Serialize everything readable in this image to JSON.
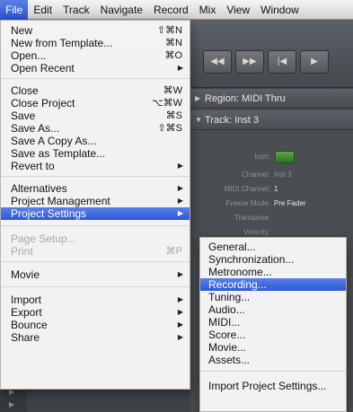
{
  "menubar": {
    "items": [
      "File",
      "Edit",
      "Track",
      "Navigate",
      "Record",
      "Mix",
      "View",
      "Window"
    ],
    "active_index": 0
  },
  "transport": {
    "buttons": [
      "◀◀",
      "▶▶",
      "|◀",
      "▶"
    ]
  },
  "inspector": {
    "region_header": "Region: MIDI Thru",
    "track_header": "Track: Inst 3",
    "icon_label": "Icon:",
    "rows": [
      {
        "label": "Channel:",
        "value": "Inst 3",
        "dim": true
      },
      {
        "label": "MIDI Channel:",
        "value": "1",
        "dim": false
      },
      {
        "label": "Freeze Mode:",
        "value": "Pre Fader",
        "dim": false
      },
      {
        "label": "Transpose:",
        "value": "",
        "dim": false
      },
      {
        "label": "Velocity:",
        "value": "",
        "dim": false
      }
    ]
  },
  "file_menu": {
    "items": [
      {
        "label": "New",
        "shortcut": "⇧⌘N"
      },
      {
        "label": "New from Template...",
        "shortcut": "⌘N"
      },
      {
        "label": "Open...",
        "shortcut": "⌘O"
      },
      {
        "label": "Open Recent",
        "submenu": true
      },
      {
        "label": "Close",
        "shortcut": "⌘W"
      },
      {
        "label": "Close Project",
        "shortcut": "⌥⌘W"
      },
      {
        "label": "Save",
        "shortcut": "⌘S"
      },
      {
        "label": "Save As...",
        "shortcut": "⇧⌘S"
      },
      {
        "label": "Save A Copy As..."
      },
      {
        "label": "Save as Template..."
      },
      {
        "label": "Revert to",
        "submenu": true
      },
      {
        "label": "Alternatives",
        "submenu": true
      },
      {
        "label": "Project Management",
        "submenu": true
      },
      {
        "label": "Project Settings",
        "submenu": true,
        "highlighted": true
      },
      {
        "label": "Page Setup...",
        "disabled": true
      },
      {
        "label": "Print",
        "shortcut": "⌘P",
        "disabled": true
      },
      {
        "label": "Movie",
        "submenu": true
      },
      {
        "label": "Import",
        "submenu": true
      },
      {
        "label": "Export",
        "submenu": true
      },
      {
        "label": "Bounce",
        "submenu": true
      },
      {
        "label": "Share",
        "submenu": true
      }
    ]
  },
  "project_settings_menu": {
    "items": [
      {
        "label": "General..."
      },
      {
        "label": "Synchronization..."
      },
      {
        "label": "Metronome..."
      },
      {
        "label": "Recording...",
        "highlighted": true
      },
      {
        "label": "Tuning..."
      },
      {
        "label": "Audio..."
      },
      {
        "label": "MIDI..."
      },
      {
        "label": "Score..."
      },
      {
        "label": "Movie..."
      },
      {
        "label": "Assets..."
      },
      {
        "label": "Import Project Settings..."
      }
    ]
  }
}
